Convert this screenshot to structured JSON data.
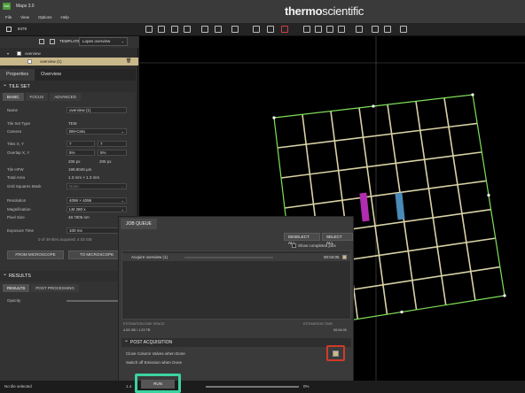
{
  "window": {
    "title": "Maps 3.0",
    "logo_text": "MA"
  },
  "menu": [
    "File",
    "View",
    "Options",
    "Help"
  ],
  "brand": {
    "part1": "thermo",
    "part2": "scientific"
  },
  "toolbar": {
    "project_name": "8479"
  },
  "layers": {
    "template_label": "TEMPLATE",
    "template_value": "Lopes overview",
    "tree": [
      {
        "label": "overview",
        "level": 0
      },
      {
        "label": "overview (1)",
        "level": 1
      }
    ]
  },
  "panel_tabs": [
    "Properties",
    "Overview"
  ],
  "tile_set": {
    "header": "TILE SET",
    "subtabs": [
      "BASIC",
      "FOCUS",
      "ADVANCED"
    ],
    "name_label": "Name",
    "name_value": "overview (1)",
    "type_label": "Tile Set Type",
    "type_value": "TEM",
    "camera_label": "Camera",
    "camera_value": "BM-Ceta",
    "tiles_label": "Tiles X, Y",
    "tiles_x": "7",
    "tiles_y": "7",
    "overlap_label": "Overlap X, Y",
    "overlap_x": "5%",
    "overlap_y": "5%",
    "overlap_px_x": "205 px",
    "overlap_px_y": "205 px",
    "hfw_label": "Tile HFW",
    "hfw_value": "199.8049 µm",
    "area_label": "Total Area",
    "area_value": "1.3 mm × 1.3 mm",
    "grid_label": "Grid Squares Mask",
    "grid_value": "None",
    "resolution_label": "Resolution",
    "resolution_value": "4096 × 4096",
    "mag_label": "Magnification",
    "mag_value": "LM 280 x",
    "pixel_label": "Pixel Size",
    "pixel_value": "48.7805 nm",
    "exposure_label": "Exposure Time",
    "exposure_value": "100 ms",
    "acquired": "0 of 49 tiles acquired; 4.03 GB",
    "from_microscope": "FROM MICROSCOPE",
    "to_microscope": "TO MICROSCOPE"
  },
  "results": {
    "header": "RESULTS",
    "subtabs": [
      "RESULTS",
      "POST PROCESSING"
    ],
    "opacity_label": "Opacity"
  },
  "job_queue": {
    "tab": "JOB QUEUE",
    "deselect_all": "DESELECT ALL",
    "select_all": "SELECT ALL",
    "show_completed": "Show completed jobs",
    "item_name": "Acquire overview (1)",
    "item_time": "00:04:05",
    "est_disk_label": "ESTIMATION DISK SPACE",
    "est_disk_value": "4.03 GB / 1.23 TB",
    "est_time_label": "ESTIMATION TIME",
    "est_time_value": "00:04:05",
    "post_acq_header": "POST ACQUISITION",
    "close_valves": "Close Column Valves when Done",
    "switch_off": "Switch off Emission when Done"
  },
  "statusbar": {
    "status": "No tile selected",
    "zoom_left": "1.4",
    "zoom_right": "0%",
    "run": "RUN"
  },
  "colors": {
    "grid_outline": "#7fe05a",
    "grid_inner": "#d9d2a6",
    "tile_magenta": "#b02cb0",
    "tile_blue": "#4a8ab8",
    "highlight_red": "#d23a2a",
    "highlight_green": "#3bd39f"
  }
}
